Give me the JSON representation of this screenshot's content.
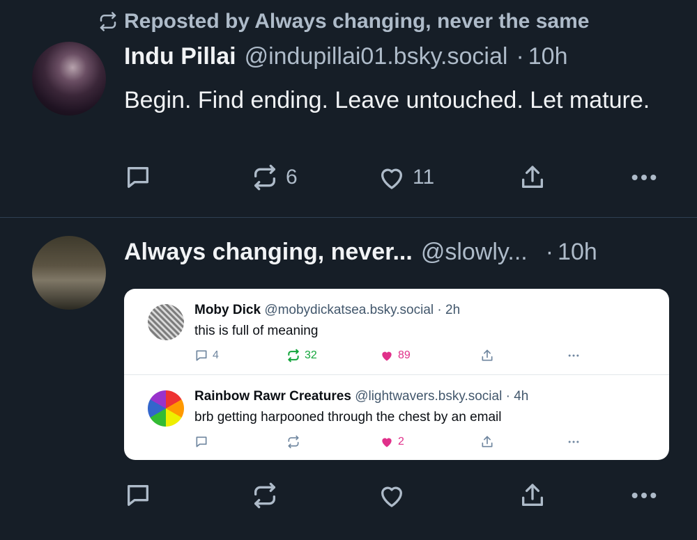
{
  "colors": {
    "background": "#161e27",
    "text": "#f1f3f5",
    "muted": "#aebbc9",
    "like_pink": "#e0308a",
    "repost_green": "#13a53b"
  },
  "post1": {
    "repost_label": "Reposted by Always changing, never the same",
    "author_name": "Indu Pillai",
    "handle": "@indupillai01.bsky.social",
    "separator": "·",
    "time": "10h",
    "text": "Begin. Find ending. Leave untouched. Let mature.",
    "repost_count": "6",
    "like_count": "11"
  },
  "post2": {
    "author_name": "Always changing, never...",
    "handle": "@slowly...",
    "separator": "·",
    "time": "10h",
    "embed": {
      "posts": [
        {
          "author_name": "Moby Dick",
          "handle": "@mobydickatsea.bsky.social",
          "separator": "·",
          "time": "2h",
          "text": "this is full of meaning",
          "reply_count": "4",
          "repost_count": "32",
          "like_count": "89"
        },
        {
          "author_name": "Rainbow Rawr Creatures",
          "handle": "@lightwavers.bsky.social",
          "separator": "·",
          "time": "4h",
          "text": "brb getting harpooned through the chest by an email",
          "reply_count": "",
          "repost_count": "",
          "like_count": "2"
        }
      ]
    }
  },
  "icons": [
    "repost-icon",
    "reply-icon",
    "like-icon",
    "share-icon",
    "more-icon"
  ]
}
